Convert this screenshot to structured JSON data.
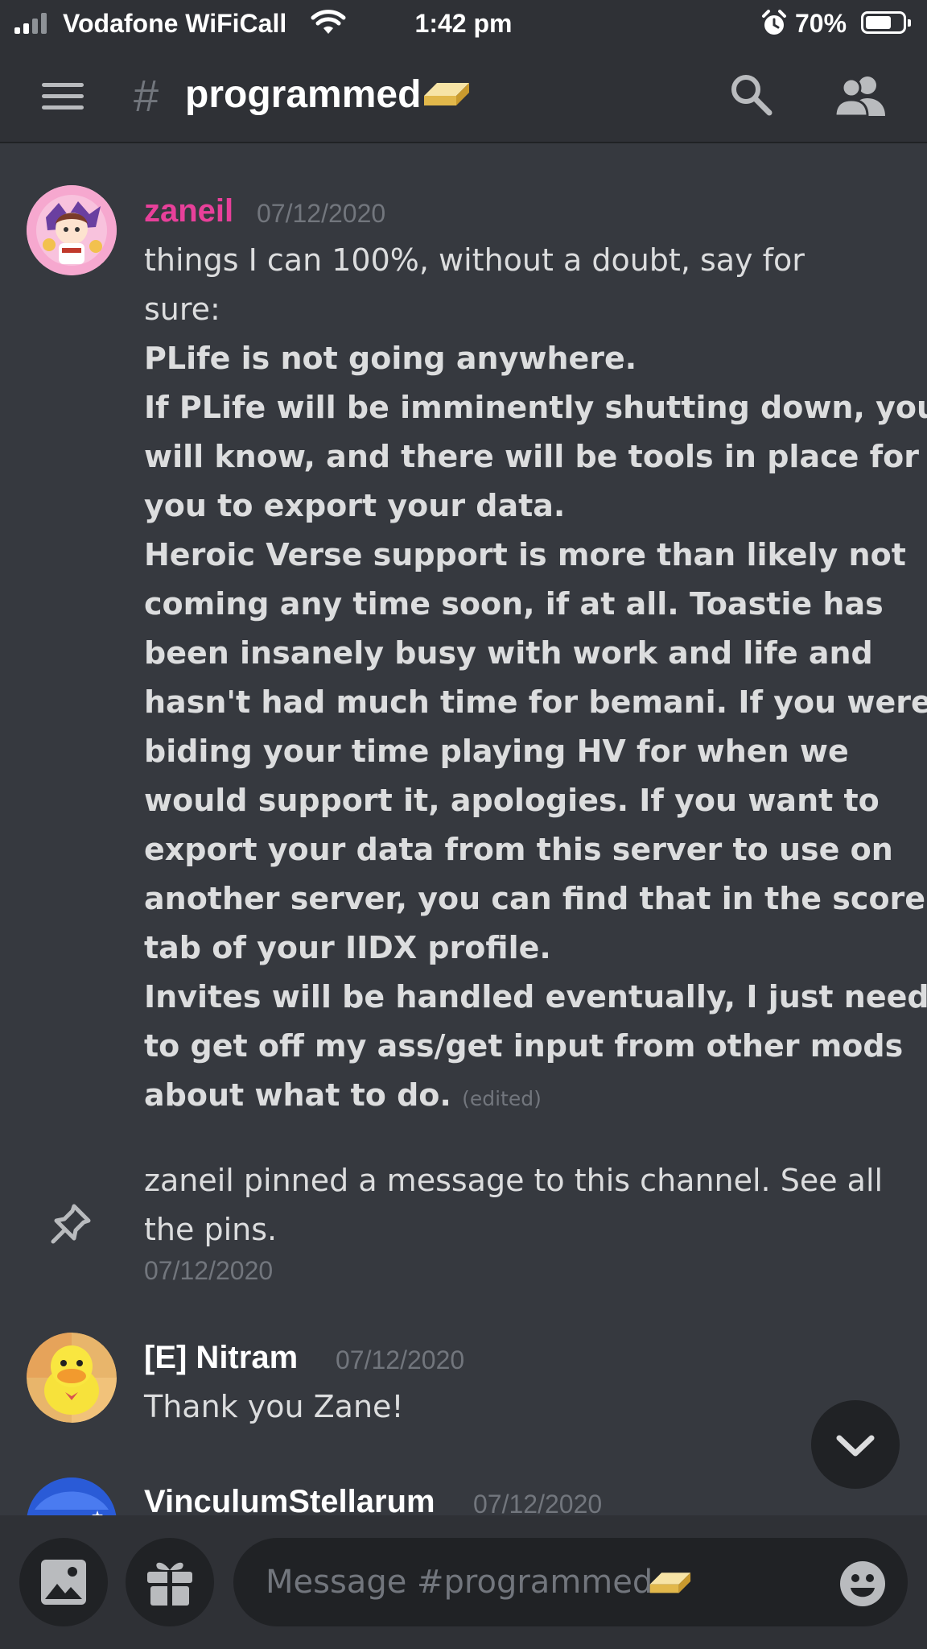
{
  "status_bar": {
    "carrier": "Vodafone WiFiCall",
    "time": "1:42 pm",
    "battery_percent": "70%",
    "battery_level": 0.7
  },
  "header": {
    "hash": "#",
    "channel_name": "programmed",
    "channel_emoji": "gold-bar-emoji"
  },
  "messages": [
    {
      "author": "zaneil",
      "author_color": "#e8409a",
      "timestamp": "07/12/2020",
      "lines": [
        "things I can 100%, without a doubt, say for",
        "sure:"
      ],
      "bold_lines": [
        "PLife is not going anywhere.",
        "If PLife will be imminently shutting down, you",
        "will know, and there will be tools in place for",
        "you to export your data.",
        "Heroic Verse support is more than likely not",
        "coming any time soon, if at all. Toastie has",
        "been insanely busy with work and life and",
        "hasn't had much time for bemani. If you were",
        "biding your time playing HV for when we",
        "would support it, apologies. If you want to",
        "export your data from this server to use on",
        "another server, you can find that in the scores",
        "tab of your IIDX profile.",
        "Invites will be handled eventually, I just need",
        "to get off my ass/get input from other mods",
        "about what to do."
      ],
      "edited": "(edited)"
    },
    {
      "system": true,
      "lines": [
        "zaneil pinned a message to this channel. See all",
        "the pins."
      ],
      "timestamp": "07/12/2020"
    },
    {
      "author": "[E] Nitram",
      "author_color": "#ffffff",
      "timestamp": "07/12/2020",
      "lines": [
        "Thank you Zane!"
      ]
    },
    {
      "author": "VinculumStellarum",
      "author_color": "#ffffff",
      "timestamp": "07/12/2020"
    }
  ],
  "composer": {
    "placeholder": "Message #programmed"
  },
  "colors": {
    "background": "#36393f",
    "top_bar": "#2f3136",
    "input": "#202225",
    "muted": "#72767d",
    "icon": "#b9bbbe"
  }
}
